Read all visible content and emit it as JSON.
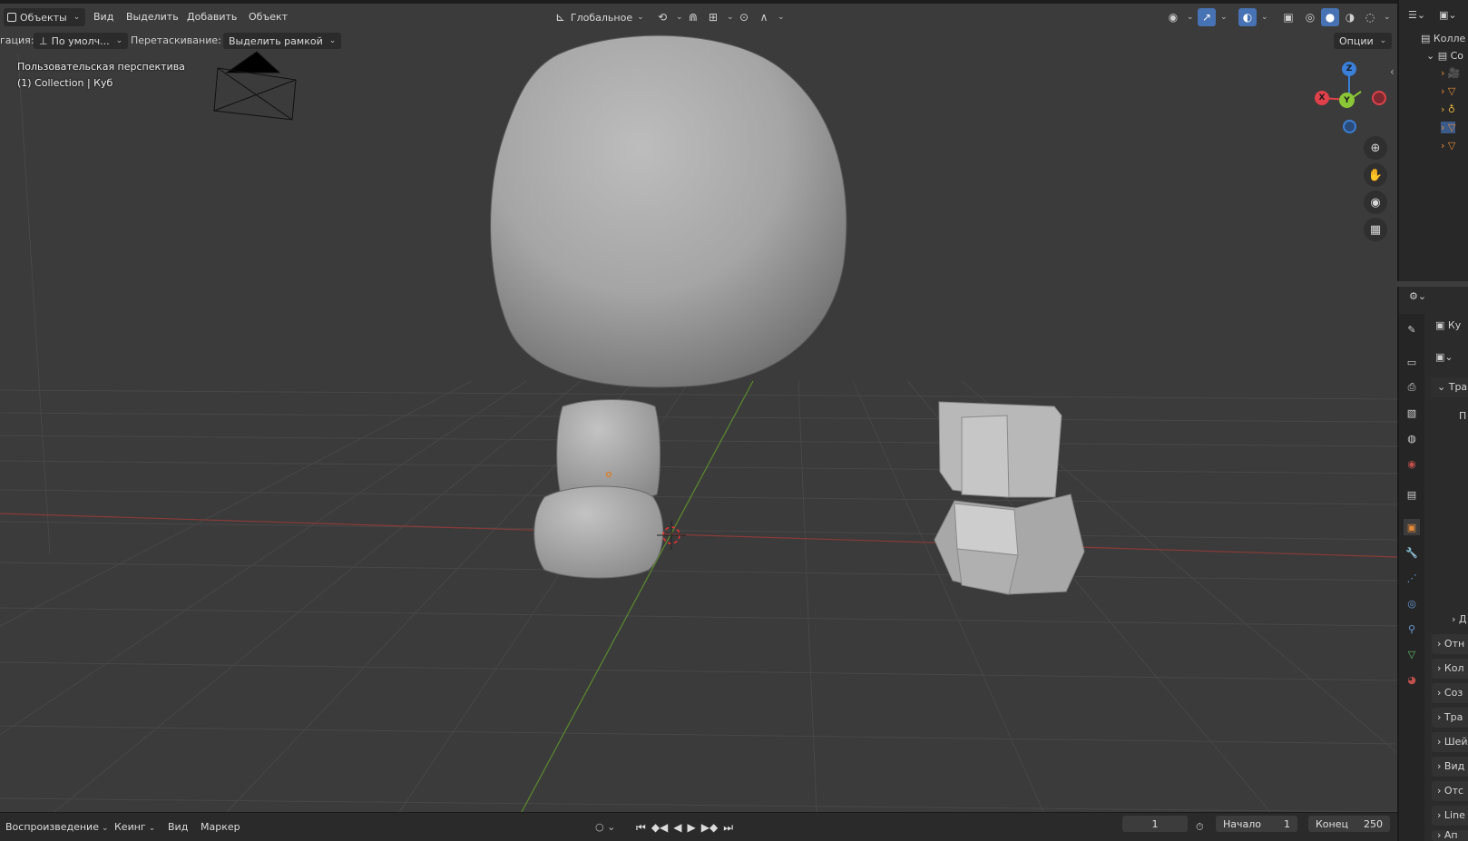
{
  "header": {
    "mode": "Объекты",
    "menu": [
      "Вид",
      "Выделить",
      "Добавить",
      "Объект"
    ],
    "transform_orientation": "Глобальное"
  },
  "toolbar": {
    "orientation_label": "гация:",
    "orientation_value": "По умолч...",
    "drag_label": "Перетаскивание:",
    "drag_value": "Выделить рамкой",
    "options_label": "Опции"
  },
  "viewport": {
    "view_name": "Пользовательская перспектива",
    "collection_info": "(1) Collection | Куб"
  },
  "gizmo": {
    "x": "X",
    "y": "Y",
    "z": "Z",
    "x_color": "#e0414b",
    "y_color": "#8bc636",
    "z_color": "#3a7fd8"
  },
  "outliner": {
    "title": "Колле",
    "collection": "Co"
  },
  "properties": {
    "object_name": "Ку",
    "section_transform": "Тра",
    "transform_sub": "П",
    "delta": "Д",
    "collapsed_sections": [
      "Отн",
      "Кол",
      "Соз",
      "Тра",
      "Шей",
      "Вид",
      "Отс",
      "Line",
      "Ап"
    ]
  },
  "timeline": {
    "playback": "Воспроизведение",
    "keying": "Кеинг",
    "view": "Вид",
    "marker": "Маркер",
    "current_frame": "1",
    "start_label": "Начало",
    "start_value": "1",
    "end_label": "Конец",
    "end_value": "250"
  }
}
